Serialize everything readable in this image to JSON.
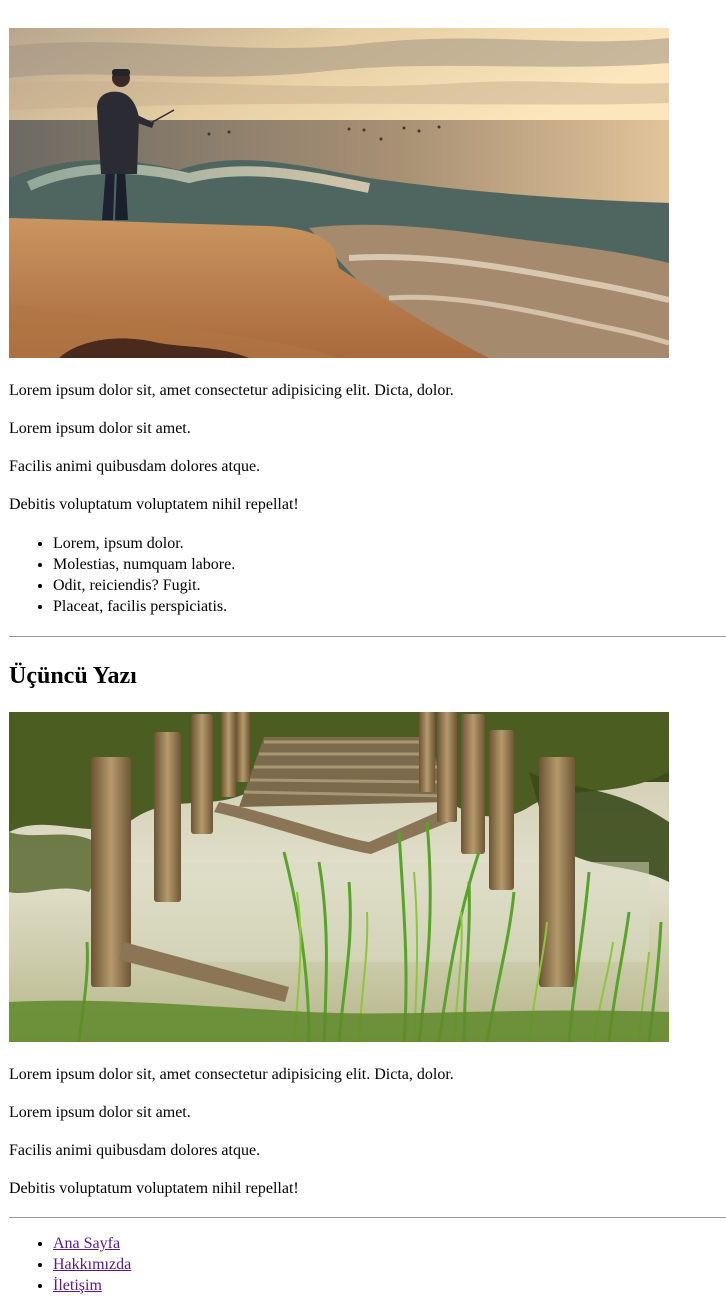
{
  "post2": {
    "image_alt": "man fishing at beach at sunset",
    "paragraphs": [
      "Lorem ipsum dolor sit, amet consectetur adipisicing elit. Dicta, dolor.",
      "Lorem ipsum dolor sit amet.",
      "Facilis animi quibusdam dolores atque.",
      "Debitis voluptatum voluptatem nihil repellat!"
    ],
    "list": [
      "Lorem, ipsum dolor.",
      "Molestias, numquam labore.",
      "Odit, reiciendis? Fugit.",
      "Placeat, facilis perspiciatis."
    ]
  },
  "post3": {
    "title": "Üçüncü Yazı",
    "image_alt": "old broken wooden pier in pond",
    "paragraphs": [
      "Lorem ipsum dolor sit, amet consectetur adipisicing elit. Dicta, dolor.",
      "Lorem ipsum dolor sit amet.",
      "Facilis animi quibusdam dolores atque.",
      "Debitis voluptatum voluptatem nihil repellat!"
    ]
  },
  "nav": {
    "links": [
      "Ana Sayfa",
      "Hakkımızda",
      "İletişim"
    ]
  },
  "colors": {
    "link_visited": "#551a8b",
    "rule": "#9a9a9a"
  }
}
